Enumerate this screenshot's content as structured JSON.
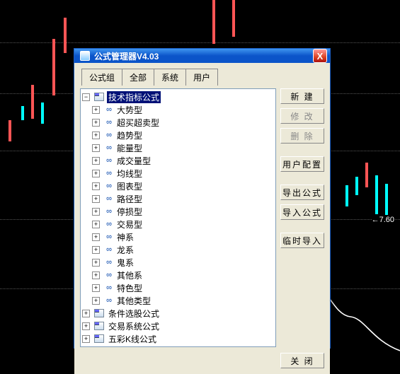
{
  "background": {
    "price_label": "7.60"
  },
  "dialog": {
    "title": "公式管理器V4.03",
    "close": "X",
    "tabs": [
      {
        "label": "公式组",
        "active": true
      },
      {
        "label": "全部",
        "active": false
      },
      {
        "label": "系统",
        "active": false
      },
      {
        "label": "用户",
        "active": false
      }
    ],
    "tree": {
      "root": {
        "expanded": true,
        "children_level1": [
          {
            "label": "技术指标公式",
            "selected": true,
            "expanded": true,
            "children": [
              "大势型",
              "超买超卖型",
              "趋势型",
              "能量型",
              "成交量型",
              "均线型",
              "图表型",
              "路径型",
              "停损型",
              "交易型",
              "神系",
              "龙系",
              "鬼系",
              "其他系",
              "特色型",
              "其他类型"
            ]
          },
          {
            "label": "条件选股公式",
            "selected": false,
            "expanded": false
          },
          {
            "label": "交易系统公式",
            "selected": false,
            "expanded": false
          },
          {
            "label": "五彩K线公式",
            "selected": false,
            "expanded": false
          }
        ]
      }
    },
    "buttons_right": {
      "new": "新 建",
      "modify": "修 改",
      "delete": "删 除",
      "user_cfg": "用户配置",
      "export": "导出公式",
      "import": "导入公式",
      "temp_import": "临时导入"
    },
    "footer": {
      "close": "关 闭"
    }
  }
}
